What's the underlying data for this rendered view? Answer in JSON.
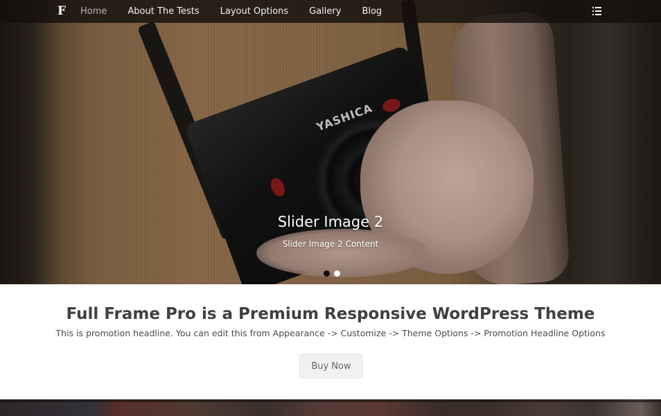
{
  "nav": {
    "logo": "F",
    "items": [
      {
        "label": "Home",
        "active": true
      },
      {
        "label": "About The Tests",
        "active": false
      },
      {
        "label": "Layout Options",
        "active": false
      },
      {
        "label": "Gallery",
        "active": false
      },
      {
        "label": "Blog",
        "active": false
      }
    ],
    "menu_toggle_icon": "list-menu-icon"
  },
  "slider": {
    "title": "Slider Image 2",
    "content": "Slider Image 2 Content",
    "camera_brand_text": "YASHICA",
    "slide_count": 2,
    "active_slide": 2
  },
  "promotion": {
    "headline": "Full Frame Pro is a Premium Responsive WordPress Theme",
    "subheadline": "This is promotion headline. You can edit this from Appearance -> Customize -> Theme Options -> Promotion Headline Options",
    "button_label": "Buy Now"
  },
  "colors": {
    "nav_bg": "#14100e",
    "nav_text": "#f2f2f2",
    "nav_active_text": "#b8b8b8",
    "headline_text": "#404040",
    "button_bg": "#f1f1f1",
    "button_text": "#666666"
  }
}
